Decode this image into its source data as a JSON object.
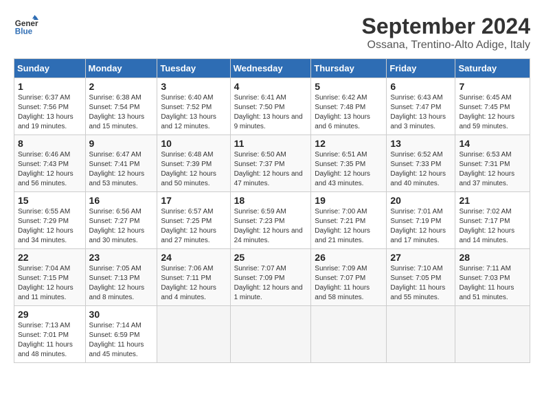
{
  "header": {
    "logo_line1": "General",
    "logo_line2": "Blue",
    "title": "September 2024",
    "subtitle": "Ossana, Trentino-Alto Adige, Italy"
  },
  "days_of_week": [
    "Sunday",
    "Monday",
    "Tuesday",
    "Wednesday",
    "Thursday",
    "Friday",
    "Saturday"
  ],
  "weeks": [
    [
      {
        "day": "1",
        "sunrise": "6:37 AM",
        "sunset": "7:56 PM",
        "daylight": "13 hours and 19 minutes."
      },
      {
        "day": "2",
        "sunrise": "6:38 AM",
        "sunset": "7:54 PM",
        "daylight": "13 hours and 15 minutes."
      },
      {
        "day": "3",
        "sunrise": "6:40 AM",
        "sunset": "7:52 PM",
        "daylight": "13 hours and 12 minutes."
      },
      {
        "day": "4",
        "sunrise": "6:41 AM",
        "sunset": "7:50 PM",
        "daylight": "13 hours and 9 minutes."
      },
      {
        "day": "5",
        "sunrise": "6:42 AM",
        "sunset": "7:48 PM",
        "daylight": "13 hours and 6 minutes."
      },
      {
        "day": "6",
        "sunrise": "6:43 AM",
        "sunset": "7:47 PM",
        "daylight": "13 hours and 3 minutes."
      },
      {
        "day": "7",
        "sunrise": "6:45 AM",
        "sunset": "7:45 PM",
        "daylight": "12 hours and 59 minutes."
      }
    ],
    [
      {
        "day": "8",
        "sunrise": "6:46 AM",
        "sunset": "7:43 PM",
        "daylight": "12 hours and 56 minutes."
      },
      {
        "day": "9",
        "sunrise": "6:47 AM",
        "sunset": "7:41 PM",
        "daylight": "12 hours and 53 minutes."
      },
      {
        "day": "10",
        "sunrise": "6:48 AM",
        "sunset": "7:39 PM",
        "daylight": "12 hours and 50 minutes."
      },
      {
        "day": "11",
        "sunrise": "6:50 AM",
        "sunset": "7:37 PM",
        "daylight": "12 hours and 47 minutes."
      },
      {
        "day": "12",
        "sunrise": "6:51 AM",
        "sunset": "7:35 PM",
        "daylight": "12 hours and 43 minutes."
      },
      {
        "day": "13",
        "sunrise": "6:52 AM",
        "sunset": "7:33 PM",
        "daylight": "12 hours and 40 minutes."
      },
      {
        "day": "14",
        "sunrise": "6:53 AM",
        "sunset": "7:31 PM",
        "daylight": "12 hours and 37 minutes."
      }
    ],
    [
      {
        "day": "15",
        "sunrise": "6:55 AM",
        "sunset": "7:29 PM",
        "daylight": "12 hours and 34 minutes."
      },
      {
        "day": "16",
        "sunrise": "6:56 AM",
        "sunset": "7:27 PM",
        "daylight": "12 hours and 30 minutes."
      },
      {
        "day": "17",
        "sunrise": "6:57 AM",
        "sunset": "7:25 PM",
        "daylight": "12 hours and 27 minutes."
      },
      {
        "day": "18",
        "sunrise": "6:59 AM",
        "sunset": "7:23 PM",
        "daylight": "12 hours and 24 minutes."
      },
      {
        "day": "19",
        "sunrise": "7:00 AM",
        "sunset": "7:21 PM",
        "daylight": "12 hours and 21 minutes."
      },
      {
        "day": "20",
        "sunrise": "7:01 AM",
        "sunset": "7:19 PM",
        "daylight": "12 hours and 17 minutes."
      },
      {
        "day": "21",
        "sunrise": "7:02 AM",
        "sunset": "7:17 PM",
        "daylight": "12 hours and 14 minutes."
      }
    ],
    [
      {
        "day": "22",
        "sunrise": "7:04 AM",
        "sunset": "7:15 PM",
        "daylight": "12 hours and 11 minutes."
      },
      {
        "day": "23",
        "sunrise": "7:05 AM",
        "sunset": "7:13 PM",
        "daylight": "12 hours and 8 minutes."
      },
      {
        "day": "24",
        "sunrise": "7:06 AM",
        "sunset": "7:11 PM",
        "daylight": "12 hours and 4 minutes."
      },
      {
        "day": "25",
        "sunrise": "7:07 AM",
        "sunset": "7:09 PM",
        "daylight": "12 hours and 1 minute."
      },
      {
        "day": "26",
        "sunrise": "7:09 AM",
        "sunset": "7:07 PM",
        "daylight": "11 hours and 58 minutes."
      },
      {
        "day": "27",
        "sunrise": "7:10 AM",
        "sunset": "7:05 PM",
        "daylight": "11 hours and 55 minutes."
      },
      {
        "day": "28",
        "sunrise": "7:11 AM",
        "sunset": "7:03 PM",
        "daylight": "11 hours and 51 minutes."
      }
    ],
    [
      {
        "day": "29",
        "sunrise": "7:13 AM",
        "sunset": "7:01 PM",
        "daylight": "11 hours and 48 minutes."
      },
      {
        "day": "30",
        "sunrise": "7:14 AM",
        "sunset": "6:59 PM",
        "daylight": "11 hours and 45 minutes."
      },
      null,
      null,
      null,
      null,
      null
    ]
  ]
}
